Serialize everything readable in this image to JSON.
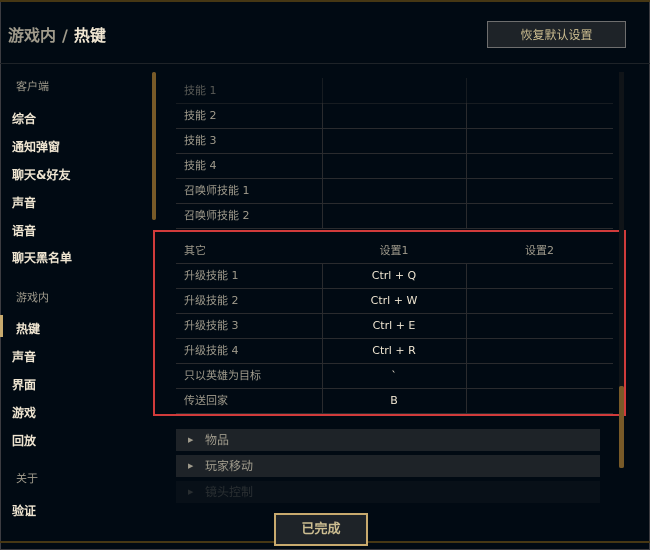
{
  "header": {
    "breadcrumb_parent": "游戏内",
    "breadcrumb_sep": "/",
    "breadcrumb_current": "热键",
    "reset_button": "恢复默认设置"
  },
  "sidebar": {
    "section_client": "客户端",
    "client_items": [
      "综合",
      "通知弹窗",
      "聊天&好友",
      "声音",
      "语音",
      "聊天黑名单"
    ],
    "section_ingame": "游戏内",
    "ingame_items": [
      "热键",
      "声音",
      "界面",
      "游戏",
      "回放"
    ],
    "active_item": "热键",
    "section_about": "关于",
    "about_items": [
      "验证"
    ]
  },
  "skills_table": {
    "rows": [
      "技能 1",
      "技能 2",
      "技能 3",
      "技能 4",
      "召唤师技能 1",
      "召唤师技能 2"
    ]
  },
  "other_table": {
    "headers": [
      "其它",
      "设置1",
      "设置2"
    ],
    "rows": [
      {
        "action": "升级技能 1",
        "key1": "Ctrl + Q",
        "key2": ""
      },
      {
        "action": "升级技能 2",
        "key1": "Ctrl + W",
        "key2": ""
      },
      {
        "action": "升级技能 3",
        "key1": "Ctrl + E",
        "key2": ""
      },
      {
        "action": "升级技能 4",
        "key1": "Ctrl + R",
        "key2": ""
      },
      {
        "action": "只以英雄为目标",
        "key1": "`",
        "key2": ""
      },
      {
        "action": "传送回家",
        "key1": "B",
        "key2": ""
      }
    ]
  },
  "groups": [
    "物品",
    "玩家移动",
    "镜头控制"
  ],
  "footer": {
    "done_button": "已完成"
  },
  "colors": {
    "accent_gold": "#c8aa6e",
    "highlight_box": "#d13b3b",
    "background": "#010a13"
  }
}
